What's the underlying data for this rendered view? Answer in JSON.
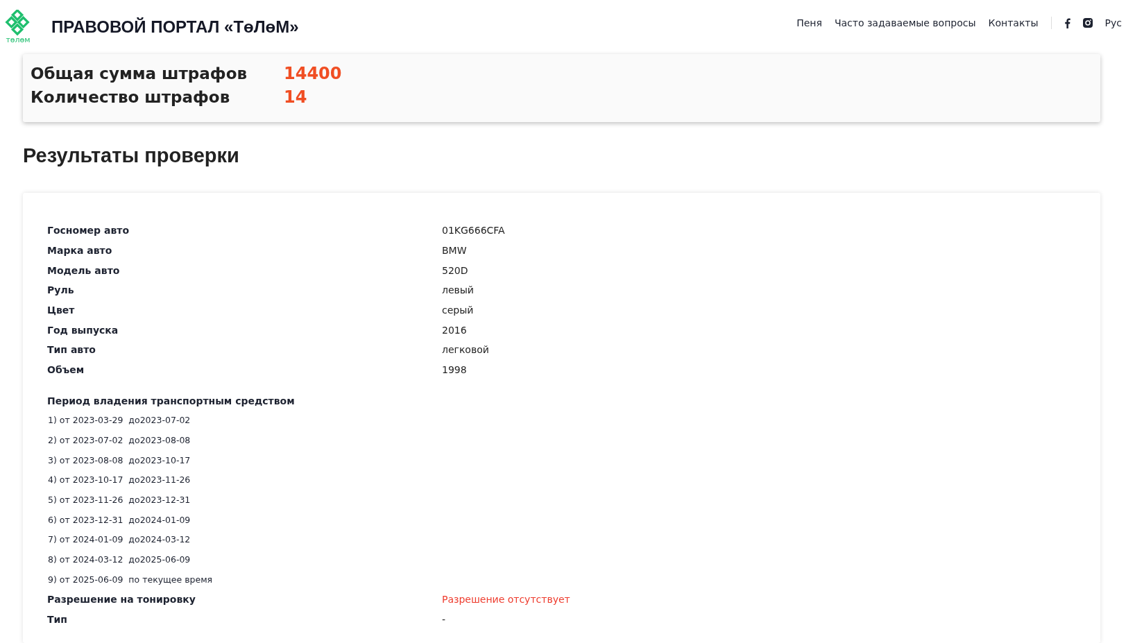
{
  "header": {
    "logo_text": "тɵлɵм",
    "title": "ПРАВОВОЙ ПОРТАЛ «ТɵЛɵМ»",
    "nav": [
      "Пеня",
      "Часто задаваемые вопросы",
      "Контакты"
    ],
    "language": "Рус"
  },
  "summary": [
    {
      "label": "Общая сумма штрафов",
      "value": "14400"
    },
    {
      "label": "Количество штрафов",
      "value": "14"
    }
  ],
  "heading": "Результаты проверки",
  "details": [
    {
      "label": "Госномер авто",
      "value": "01KG666CFA",
      "kind": "plain"
    },
    {
      "label": "Марка авто",
      "value": "BMW",
      "kind": "plain"
    },
    {
      "label": "Модель авто",
      "value": "520D",
      "kind": "plain"
    },
    {
      "label": "Руль",
      "value": "левый",
      "kind": "plain"
    },
    {
      "label": "Цвет",
      "value": "серый",
      "kind": "plain"
    },
    {
      "label": "Год выпуска",
      "value": "2016",
      "kind": "plain"
    },
    {
      "label": "Тип авто",
      "value": "легковой",
      "kind": "plain"
    },
    {
      "label": "Объем",
      "value": "1998",
      "kind": "plain"
    }
  ],
  "ownership": {
    "title": "Период владения транспортным средством",
    "periods": [
      {
        "from": "1) от 2023-03-29",
        "to": "до2023-07-02"
      },
      {
        "from": "2) от 2023-07-02",
        "to": "до2023-08-08"
      },
      {
        "from": "3) от 2023-08-08",
        "to": "до2023-10-17"
      },
      {
        "from": "4) от 2023-10-17",
        "to": "до2023-11-26"
      },
      {
        "from": "5) от 2023-11-26",
        "to": "до2023-12-31"
      },
      {
        "from": "6) от 2023-12-31",
        "to": "до2024-01-09"
      },
      {
        "from": "7) от 2024-01-09",
        "to": "до2024-03-12"
      },
      {
        "from": "8) от 2024-03-12",
        "to": "до2025-06-09"
      },
      {
        "from": "9) от 2025-06-09",
        "to": "по текущее время"
      }
    ]
  },
  "extra": [
    {
      "label": "Разрешение на тонировку",
      "value": "Разрешение отсутствует",
      "kind": "alert"
    },
    {
      "label": "Тип",
      "value": "-",
      "kind": "plain"
    }
  ]
}
